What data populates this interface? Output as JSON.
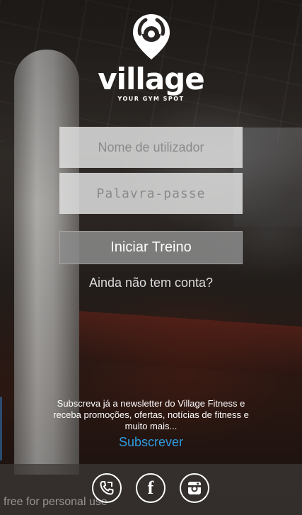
{
  "brand": {
    "name": "village",
    "tagline": "YOUR GYM SPOT"
  },
  "login": {
    "username_placeholder": "Nome de utilizador",
    "password_placeholder": "Palavra-passe",
    "submit_label": "Iniciar Treino",
    "no_account_link": "Ainda não tem conta?"
  },
  "newsletter": {
    "text": "Subscreva já a newsletter do Village Fitness e receba promoções, ofertas, notícias de fitness e muito mais...",
    "subscribe_label": "Subscrever"
  },
  "social": [
    {
      "icon": "phone-icon"
    },
    {
      "icon": "facebook-icon"
    },
    {
      "icon": "instagram-icon"
    }
  ],
  "watermark": "free for personal use",
  "colors": {
    "link": "#2f9be0",
    "button_bg": "#8c8c8c",
    "field_bg": "#dedede"
  }
}
